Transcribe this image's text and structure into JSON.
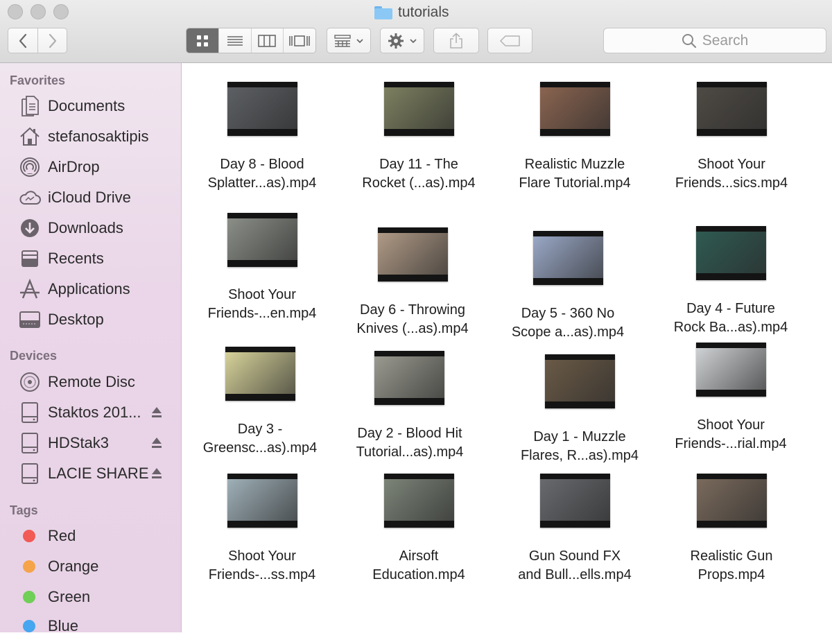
{
  "window": {
    "title": "tutorials"
  },
  "toolbar": {
    "search_placeholder": "Search"
  },
  "sidebar": {
    "favorites_header": "Favorites",
    "favorites": [
      {
        "label": "Documents",
        "icon": "documents-icon"
      },
      {
        "label": "stefanosaktipis",
        "icon": "home-icon"
      },
      {
        "label": "AirDrop",
        "icon": "airdrop-icon"
      },
      {
        "label": "iCloud Drive",
        "icon": "cloud-icon"
      },
      {
        "label": "Downloads",
        "icon": "downloads-icon"
      },
      {
        "label": "Recents",
        "icon": "recents-icon"
      },
      {
        "label": "Applications",
        "icon": "applications-icon"
      },
      {
        "label": "Desktop",
        "icon": "desktop-icon"
      }
    ],
    "devices_header": "Devices",
    "devices": [
      {
        "label": "Remote Disc",
        "icon": "disc-icon",
        "eject": false
      },
      {
        "label": "Staktos 201...",
        "icon": "drive-icon",
        "eject": true
      },
      {
        "label": "HDStak3",
        "icon": "drive-icon",
        "eject": true
      },
      {
        "label": "LACIE SHARE",
        "icon": "drive-icon",
        "eject": true
      }
    ],
    "tags_header": "Tags",
    "tags": [
      {
        "label": "Red",
        "color": "#f25a55"
      },
      {
        "label": "Orange",
        "color": "#f5a44a"
      },
      {
        "label": "Green",
        "color": "#6fcf56"
      },
      {
        "label": "Blue",
        "color": "#46a6ef"
      }
    ]
  },
  "files": [
    {
      "line1": "Day 8 - Blood",
      "line2": "Splatter...as).mp4",
      "tint": "#5d6064"
    },
    {
      "line1": "Day 11 - The",
      "line2": "Rocket (...as).mp4",
      "tint": "#7d8060"
    },
    {
      "line1": "Realistic Muzzle",
      "line2": "Flare Tutorial.mp4",
      "tint": "#8a6450"
    },
    {
      "line1": "Shoot Your",
      "line2": "Friends...sics.mp4",
      "tint": "#4e4a44"
    },
    {
      "line1": "Shoot Your",
      "line2": "Friends-...en.mp4",
      "tint": "#8b8f88"
    },
    {
      "line1": "Day 6 - Throwing",
      "line2": "Knives (...as).mp4",
      "tint": "#b09a86"
    },
    {
      "line1": "Day 5 - 360 No",
      "line2": "Scope a...as).mp4",
      "tint": "#9aa8c6"
    },
    {
      "line1": "Day 4 - Future",
      "line2": "Rock Ba...as).mp4",
      "tint": "#2f5a52"
    },
    {
      "line1": "Day 3 -",
      "line2": "Greensc...as).mp4",
      "tint": "#d6d29a"
    },
    {
      "line1": "Day 2 - Blood Hit",
      "line2": "Tutorial...as).mp4",
      "tint": "#9a9a90"
    },
    {
      "line1": "Day 1 - Muzzle",
      "line2": "Flares, R...as).mp4",
      "tint": "#6a5a46"
    },
    {
      "line1": "Shoot Your",
      "line2": "Friends-...rial.mp4",
      "tint": "#cfd2d4"
    },
    {
      "line1": "Shoot Your",
      "line2": "Friends-...ss.mp4",
      "tint": "#9fb0b8"
    },
    {
      "line1": "Airsoft",
      "line2": "Education.mp4",
      "tint": "#7c8478"
    },
    {
      "line1": "Gun Sound FX",
      "line2": "and Bull...ells.mp4",
      "tint": "#686a6e"
    },
    {
      "line1": "Realistic Gun",
      "line2": "Props.mp4",
      "tint": "#7a6a5c"
    }
  ]
}
